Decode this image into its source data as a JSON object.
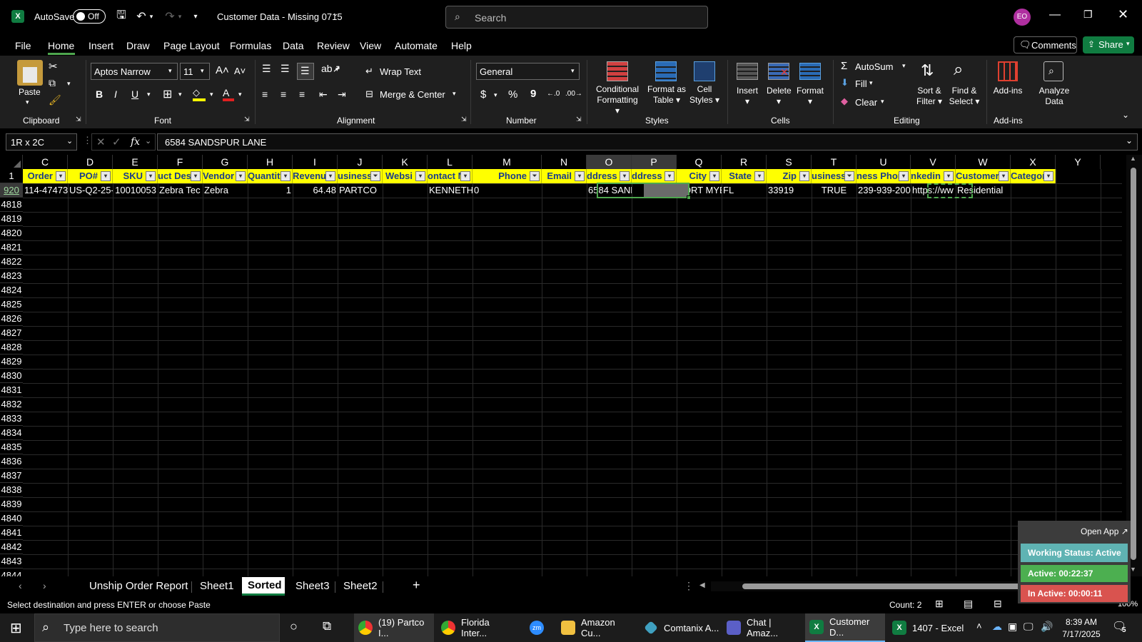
{
  "titlebar": {
    "autosave_label": "AutoSave",
    "autosave_state": "Off",
    "doc_title": "Customer Data - Missing 0715",
    "search_placeholder": "Search",
    "avatar_initials": "EO"
  },
  "menu": {
    "items": [
      "File",
      "Home",
      "Insert",
      "Draw",
      "Page Layout",
      "Formulas",
      "Data",
      "Review",
      "View",
      "Automate",
      "Help"
    ],
    "active": "Home",
    "comments_label": "Comments",
    "share_label": "Share"
  },
  "ribbon": {
    "clipboard": {
      "paste": "Paste",
      "group": "Clipboard"
    },
    "font": {
      "name": "Aptos Narrow",
      "size": "11",
      "group": "Font",
      "bold": "B",
      "italic": "I",
      "underline": "U"
    },
    "alignment": {
      "wrap": "Wrap Text",
      "merge": "Merge & Center",
      "group": "Alignment"
    },
    "number": {
      "format": "General",
      "group": "Number",
      "dollar": "$",
      "percent": "%",
      "comma": "9"
    },
    "styles": {
      "conditional": "Conditional",
      "conditional2": "Formatting",
      "format_table": "Format as",
      "format_table2": "Table",
      "cell_styles": "Cell",
      "cell_styles2": "Styles",
      "group": "Styles"
    },
    "cells": {
      "insert": "Insert",
      "delete": "Delete",
      "format": "Format",
      "group": "Cells"
    },
    "editing": {
      "autosum": "AutoSum",
      "fill": "Fill",
      "clear": "Clear",
      "sort": "Sort &",
      "sort2": "Filter",
      "find": "Find &",
      "find2": "Select",
      "group": "Editing"
    },
    "addins": {
      "addins": "Add-ins",
      "analyze": "Analyze",
      "analyze2": "Data",
      "group": "Add-ins"
    }
  },
  "formula_bar": {
    "name_box": "1R x 2C",
    "fx": "fx",
    "value": "6584 SANDSPUR LANE"
  },
  "columns": [
    "C",
    "D",
    "E",
    "F",
    "G",
    "H",
    "I",
    "J",
    "K",
    "L",
    "M",
    "N",
    "O",
    "P",
    "Q",
    "R",
    "S",
    "T",
    "U",
    "V",
    "W",
    "X",
    "Y"
  ],
  "header_row": {
    "row_number": "1",
    "cells": [
      "Order",
      "PO#",
      "SKU",
      "uct Des",
      "Vendor",
      "Quantity",
      "Revenu",
      "usiness I",
      "Websi",
      "ontact N",
      "Phone",
      "Email",
      "ddress L",
      "ddress L",
      "City",
      "State",
      "Zip",
      "usiness",
      "ness Phon",
      "nkedin P",
      "Customer T",
      "Category"
    ]
  },
  "data_row": {
    "row_number": "920",
    "cells": [
      "114-47473",
      "US-Q2-25-",
      "10010053",
      "Zebra Tec",
      "Zebra",
      "1",
      "64.48",
      "PARTCO",
      "",
      "KENNETH",
      "0",
      "",
      "6584 SAND",
      "",
      "FORT MYE",
      "FL",
      "33919",
      "TRUE",
      "239-939-200",
      "https://ww",
      "Residential",
      ""
    ]
  },
  "row_numbers": [
    "4818",
    "4819",
    "4820",
    "4821",
    "4822",
    "4823",
    "4824",
    "4825",
    "4826",
    "4827",
    "4828",
    "4829",
    "4830",
    "4831",
    "4832",
    "4833",
    "4834",
    "4835",
    "4836",
    "4837",
    "4838",
    "4839",
    "4840",
    "4841",
    "4842",
    "4843",
    "4844"
  ],
  "sheet_tabs": [
    "Unship Order Report",
    "Sheet1",
    "Sorted",
    "Sheet3",
    "Sheet2"
  ],
  "active_tab": "Sorted",
  "status": {
    "message": "Select destination and press ENTER or choose Paste",
    "count": "Count: 2",
    "zoom": "100%"
  },
  "tracker": {
    "open_app": "Open App ↗",
    "working": "Working Status: Active",
    "active": "Active: 00:22:37",
    "inactive": "In Active: 00:00:11"
  },
  "taskbar": {
    "search_placeholder": "Type here to search",
    "apps": [
      "(19) Partco I...",
      "Florida Inter...",
      "",
      "Amazon Cu...",
      "Comtanix A...",
      "Chat | Amaz...",
      "Customer D...",
      "1407 - Excel"
    ],
    "time": "8:39 AM",
    "date": "7/17/2025",
    "notif_count": "5"
  },
  "colors": {
    "header_fill": "#ffff00",
    "header_text": "#1a3c8a",
    "accent_green": "#107c41",
    "status_active": "#4caf50",
    "status_inactive": "#d9534f",
    "status_working": "#5fb3b3"
  }
}
